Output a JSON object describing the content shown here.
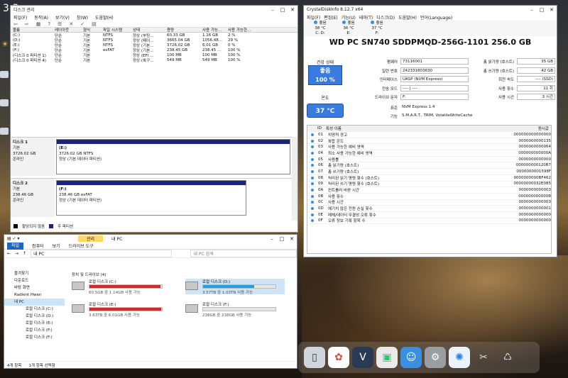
{
  "clock": "3:3",
  "disk_mgmt": {
    "title": "디스크 관리",
    "menu": [
      "파일(F)",
      "동작(A)",
      "보기(V)",
      "창(W)",
      "도움말(H)"
    ],
    "columns": [
      "볼륨",
      "레이아웃",
      "형식",
      "파일 시스템",
      "상태",
      "용량",
      "사용 가능...",
      "사용 가능한..."
    ],
    "volumes": [
      [
        "(C:)",
        "단순",
        "기본",
        "NTFS",
        "정상 (부팅...",
        "60.33 GB",
        "1.16 GB",
        "2 %"
      ],
      [
        "(D:)",
        "단순",
        "기본",
        "NTFS",
        "정상 (페이...",
        "3665.04 GB",
        "1056.48...",
        "29 %"
      ],
      [
        "(E:)",
        "단순",
        "기본",
        "NTFS",
        "정상 (기본...",
        "3726.02 GB",
        "6.01 GB",
        "0 %"
      ],
      [
        "(F:)",
        "단순",
        "기본",
        "exFAT",
        "정상 (기본...",
        "238.45 GB",
        "238.45 ...",
        "100 %"
      ],
      [
        "(디스크 0 파티션 1)",
        "단순",
        "기본",
        "",
        "정상 (EFI ...",
        "100 MB",
        "100 MB",
        "100 %"
      ],
      [
        "(디스크 0 파티션 4)",
        "단순",
        "기본",
        "",
        "정상 (복구...",
        "549 MB",
        "549 MB",
        "100 %"
      ]
    ],
    "disks": [
      {
        "name": "디스크 1",
        "type": "기본",
        "size": "3726.02 GB",
        "state": "온라인",
        "part_name": "(E:)",
        "part_size": "3726.02 GB NTFS",
        "part_state": "정상 (기본 데이터 파티션)"
      },
      {
        "name": "디스크 2",
        "type": "기본",
        "size": "238.46 GB",
        "state": "온라인",
        "part_name": "(F:)",
        "part_size": "238.46 GB exFAT",
        "part_state": "정상 (기본 데이터 파티션)"
      }
    ],
    "legend": [
      "할당되지 않음",
      "주 파티션"
    ]
  },
  "explorer": {
    "title": "내 PC",
    "ribbon_tab": "관리",
    "tabs": [
      "파일",
      "컴퓨터",
      "보기",
      "드라이브 도구"
    ],
    "address": "내 PC",
    "search_placeholder": "내 PC 검색",
    "section": "장치 및 드라이브 (4)",
    "sidebar": [
      "즐겨찾기",
      "다운로드",
      "바탕 화면",
      "Radient Hwen",
      "내 PC",
      "로컬 디스크 (C:)",
      "로컬 디스크 (D:)",
      "로컬 디스크 (E:)",
      "로컬 디스크 (F:)",
      "로컬 디스크 (F:)"
    ],
    "drives": [
      {
        "name": "로컬 디스크 (C:)",
        "space": "60.5GB 중 1.14GB 사용 가능",
        "fill": 0.98,
        "color": "#da2626"
      },
      {
        "name": "로컬 디스크 (D:)",
        "space": "3.57TB 중 1.03TB 사용 가능",
        "fill": 0.71,
        "color": "#26a0da"
      },
      {
        "name": "로컬 디스크 (E:)",
        "space": "3.63TB 중 6.01GB 사용 가능",
        "fill": 0.99,
        "color": "#da2626"
      },
      {
        "name": "로컬 디스크 (F:)",
        "space": "238GB 중 238GB 사용 가능",
        "fill": 0.0,
        "color": "#26a0da"
      }
    ],
    "status_items": "4개 항목",
    "status_selected": "1개 항목 선택함"
  },
  "cdi": {
    "title": "CrystalDiskInfo 8.12.7 x64",
    "menu": [
      "파일(F)",
      "편집(E)",
      "기능(U)",
      "테마(T)",
      "디스크(D)",
      "도움말(H)",
      "언어(Language)"
    ],
    "drives": [
      {
        "state": "좋음",
        "temp": "38 °C",
        "letter": "C: D:"
      },
      {
        "state": "좋음",
        "temp": "36 °C",
        "letter": "E:"
      },
      {
        "state": "좋음",
        "temp": "37 °C",
        "letter": "F:"
      }
    ],
    "model": "WD PC SN740 SDDPMQD-256G-1101 256.0 GB",
    "health_label": "건강 상태",
    "health": "좋음",
    "health_pct": "100 %",
    "temp_label": "온도",
    "temp": "37 °C",
    "fields": [
      [
        "펌웨어",
        "73116001"
      ],
      [
        "일련 번호",
        "242331803630"
      ],
      [
        "인터페이스",
        "UASP (NVM Express)"
      ],
      [
        "전송 모드",
        "---- | ----"
      ],
      [
        "드라이브 문자",
        "F:"
      ]
    ],
    "right_fields": [
      [
        "총 읽기량 (호스트)",
        "35 GB"
      ],
      [
        "총 쓰기량 (호스트)",
        "42 GB"
      ],
      [
        "회전 속도",
        "---- (SSD)"
      ],
      [
        "사용 횟수",
        "11 회"
      ],
      [
        "사용 시간",
        "3 시간"
      ]
    ],
    "standard_label": "표준",
    "standard": "NVM Express 1.4",
    "features_label": "기능",
    "features": "S.M.A.R.T., TRIM, VolatileWriteCache",
    "smart_cols": [
      "ID",
      "특성 이름",
      "원시값"
    ],
    "smart": [
      [
        "01",
        "치명적 경고",
        "000000000000000"
      ],
      [
        "02",
        "복합 온도",
        "0000000000135"
      ],
      [
        "03",
        "사용 가능한 예비 영역",
        "0000000000064"
      ],
      [
        "04",
        "최소 사용 가능한 예비 영역",
        "000000000000A"
      ],
      [
        "05",
        "사용률",
        "0000000000000"
      ],
      [
        "06",
        "총 읽기량 (호스트)",
        "000000000120B7"
      ],
      [
        "07",
        "총 쓰기량 (호스트)",
        "0000000001598F"
      ],
      [
        "08",
        "처리된 읽기 명령 횟수 (호스트)",
        "0000000000BF462"
      ],
      [
        "09",
        "처리된 쓰기 명령 횟수 (호스트)",
        "00000000032E085"
      ],
      [
        "0A",
        "컨트롤러 바쁜 시간",
        "0000000000003"
      ],
      [
        "0B",
        "사용 횟수",
        "000000000000B"
      ],
      [
        "0C",
        "사용 시간",
        "0000000000003"
      ],
      [
        "0D",
        "예기치 않은 전원 손실 횟수",
        "0000000000001"
      ],
      [
        "0E",
        "매체/데이터 무결성 오류 횟수",
        "0000000000000"
      ],
      [
        "0F",
        "오류 정보 기록 항목 수",
        "0000000000000"
      ]
    ]
  }
}
